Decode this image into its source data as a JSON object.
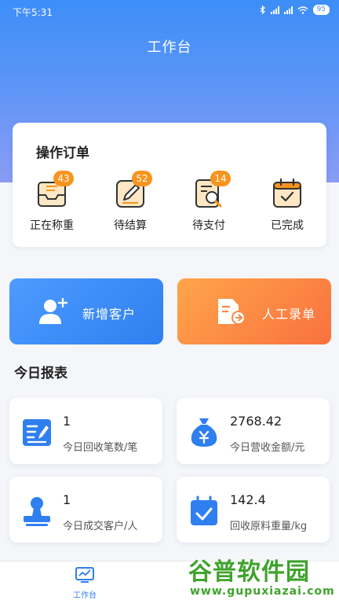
{
  "status_bar": {
    "time": "下午5:31",
    "battery": "95"
  },
  "header": {
    "title": "工作台"
  },
  "orders": {
    "heading": "操作订单",
    "items": [
      {
        "label": "正在称重",
        "badge": "43",
        "icon": "weighing-tray-icon"
      },
      {
        "label": "待结算",
        "badge": "52",
        "icon": "settle-pen-icon"
      },
      {
        "label": "待支付",
        "badge": "14",
        "icon": "payment-search-icon"
      },
      {
        "label": "已完成",
        "badge": "",
        "icon": "calendar-check-icon"
      }
    ]
  },
  "actions": {
    "add_customer": "新增客户",
    "manual_entry": "人工录单"
  },
  "report": {
    "heading": "今日报表",
    "cards": [
      {
        "value": "1",
        "label": "今日回收笔数/笔",
        "icon": "edit-list-icon"
      },
      {
        "value": "2768.42",
        "label": "今日营收金额/元",
        "icon": "money-bag-icon"
      },
      {
        "value": "1",
        "label": "今日成交客户/人",
        "icon": "stamp-icon"
      },
      {
        "value": "142.4",
        "label": "回收原料重量/kg",
        "icon": "calendar-check-icon"
      }
    ]
  },
  "tabbar": {
    "workbench": "工作台"
  },
  "watermark": {
    "brand": "谷普软件园",
    "url": "www.gupuxiazai.com"
  },
  "colors": {
    "primary": "#2f7ff0",
    "accent_orange": "#f7941d",
    "watermark_green": "#3fa32c"
  }
}
